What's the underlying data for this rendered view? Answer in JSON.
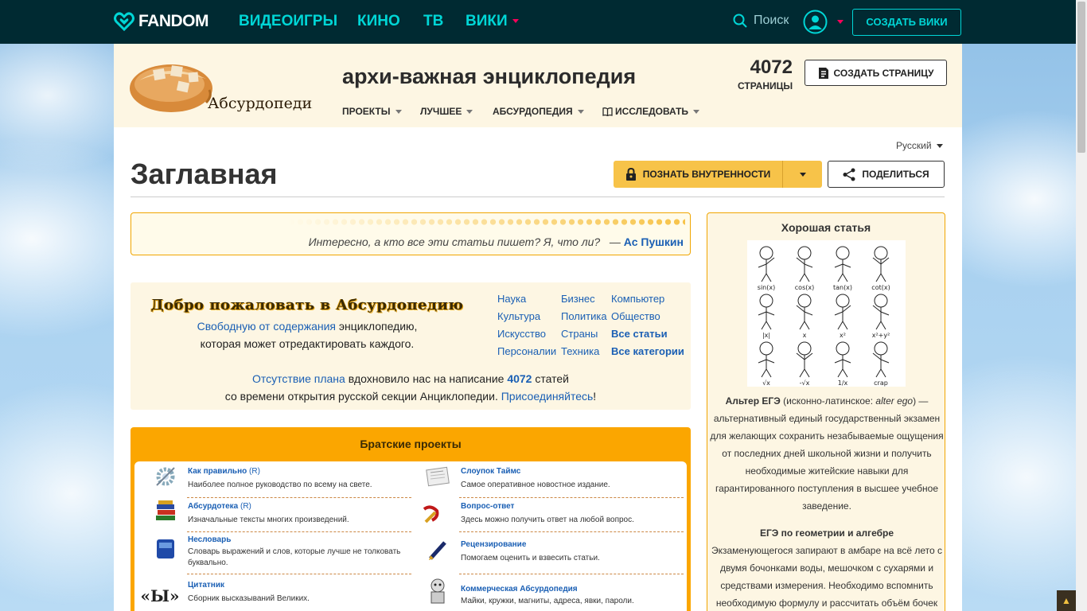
{
  "topbar": {
    "brand": "FANDOM",
    "nav": [
      "ВИДЕОИГРЫ",
      "КИНО",
      "ТВ",
      "ВИКИ"
    ],
    "search_label": "Поиск",
    "create_wiki": "СОЗДАТЬ ВИКИ"
  },
  "wiki": {
    "logo_text": "АбсурдопедиЯ",
    "title": "архи-важная энциклопедия",
    "page_count": "4072",
    "page_count_label": "СТРАНИЦЫ",
    "create_page": "СОЗДАТЬ СТРАНИЦУ",
    "nav": [
      "ПРОЕКТЫ",
      "ЛУЧШЕЕ",
      "АБСУРДОПЕДИЯ",
      "ИССЛЕДОВАТЬ"
    ]
  },
  "page": {
    "language": "Русский",
    "title": "Заглавная",
    "edit_label": "ПОЗНАТЬ ВНУТРЕННОСТИ",
    "share_label": "ПОДЕЛИТЬСЯ"
  },
  "quote": {
    "text": "Интересно, а кто все эти статьи пишет? Я, что ли?",
    "dash": "—",
    "author": "Ас Пушкин"
  },
  "welcome": {
    "heading": "Добро пожаловать в Абсурдопедию",
    "line1_link": "Свободную от содержания",
    "line1_rest": " энциклопедию,",
    "line2": "которая может отредактировать каждого.",
    "bottom_link1": "Отсутствие плана",
    "bottom_mid": " вдохновило нас на написание ",
    "bottom_count": "4072",
    "bottom_end": " статей",
    "bottom_line2": "со времени открытия русской секции Анциклопедии. ",
    "bottom_link2": "Присоединяйтесь",
    "bottom_excl": "!"
  },
  "categories": {
    "col1": [
      "Наука",
      "Культура",
      "Искусство",
      "Персоналии"
    ],
    "col2": [
      "Бизнес",
      "Политика",
      "Страны",
      "Техника"
    ],
    "col3": [
      "Компьютер",
      "Общество",
      "Все статьи",
      "Все категории"
    ]
  },
  "sister": {
    "heading": "Братские проекты",
    "items": [
      {
        "title": "Как правильно",
        "r": " (R)",
        "desc": "Наиболее полное руководство по всему на свете."
      },
      {
        "title": "Слоупок Таймс",
        "r": "",
        "desc": "Самое оперативное новостное издание."
      },
      {
        "title": "Абсурдотека",
        "r": " (R)",
        "desc": "Изначальные тексты многих произведений."
      },
      {
        "title": "Вопрос-ответ",
        "r": "",
        "desc": "Здесь можно получить ответ на любой вопрос."
      },
      {
        "title": "Несловарь",
        "r": "",
        "desc": "Словарь выражений и слов, которые лучше не толковать буквально."
      },
      {
        "title": "Рецензирование",
        "r": "",
        "desc": "Помогаем оценить и взвесить статьи."
      },
      {
        "title": "Цитатник",
        "r": "",
        "desc": "Сборник высказываний Великих."
      },
      {
        "title": "Коммерческая Абсурдопедия",
        "r": "",
        "desc": "Майки, кружки, магниты, адреса, явки, пароли."
      }
    ],
    "citation_glyph": "«Ы»"
  },
  "aside": {
    "heading": "Хорошая статья",
    "sketch_labels": [
      "sin(x)",
      "cos(x)",
      "tan(x)",
      "cot(x)",
      "|x|",
      "x",
      "x²",
      "x²+y²",
      "√x",
      "-√x",
      "1/x",
      "crap"
    ],
    "article_bold": "Альтер ЕГЭ",
    "article_paren": " (исконно-латинское: ",
    "article_italic": "alter ego",
    "article_rest": ") — альтернативный единый государственный экзамен для желающих сохранить незабываемые ощущения от последних дней школьной жизни и получить необходимые житейские навыки для гарантированного поступления в высшее учебное заведение.",
    "heading2": "ЕГЭ по геометрии и алгебре",
    "text2": "Экзаменующегося запирают в амбаре на всё лето с двумя бочонками воды, мешочком с сухарями и средствами измерения. Необходимо вспомнить необходимую формулу и рассчитать объём бочек"
  },
  "colors": {
    "topbar": "#002a32",
    "accent": "#00d6d6",
    "gold": "#f7c349",
    "orange": "#fba600"
  }
}
